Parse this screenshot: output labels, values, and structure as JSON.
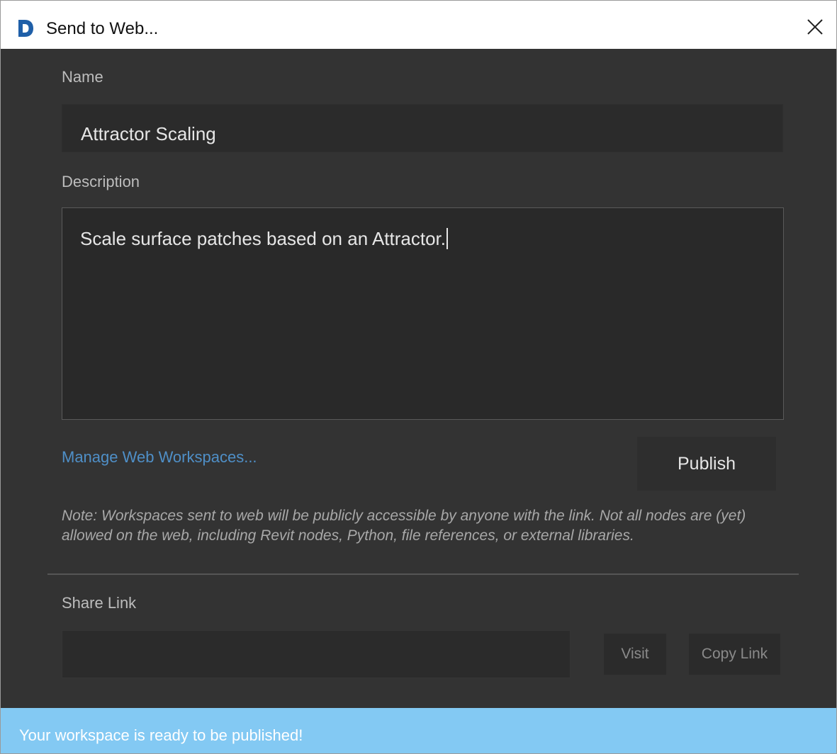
{
  "window": {
    "title": "Send to Web...",
    "app_icon_letter": "D"
  },
  "form": {
    "name_label": "Name",
    "name_value": "Attractor Scaling",
    "description_label": "Description",
    "description_value": "Scale surface patches based on an Attractor.",
    "manage_link": "Manage Web Workspaces...",
    "publish_label": "Publish",
    "note": "Note: Workspaces sent to web will be publicly accessible by anyone with the link. Not all nodes are (yet) allowed on the web, including Revit nodes, Python, file references, or external libraries."
  },
  "share": {
    "label": "Share Link",
    "link_value": "",
    "visit_label": "Visit",
    "copy_label": "Copy Link"
  },
  "status": {
    "message": "Your workspace is ready to be published!"
  },
  "colors": {
    "background": "#333333",
    "link": "#4f8fc7",
    "status_bar": "#83c9f3",
    "app_icon": "#1f5fa8"
  },
  "icons": {
    "app": "dynamo-app-icon",
    "close": "close-icon"
  }
}
